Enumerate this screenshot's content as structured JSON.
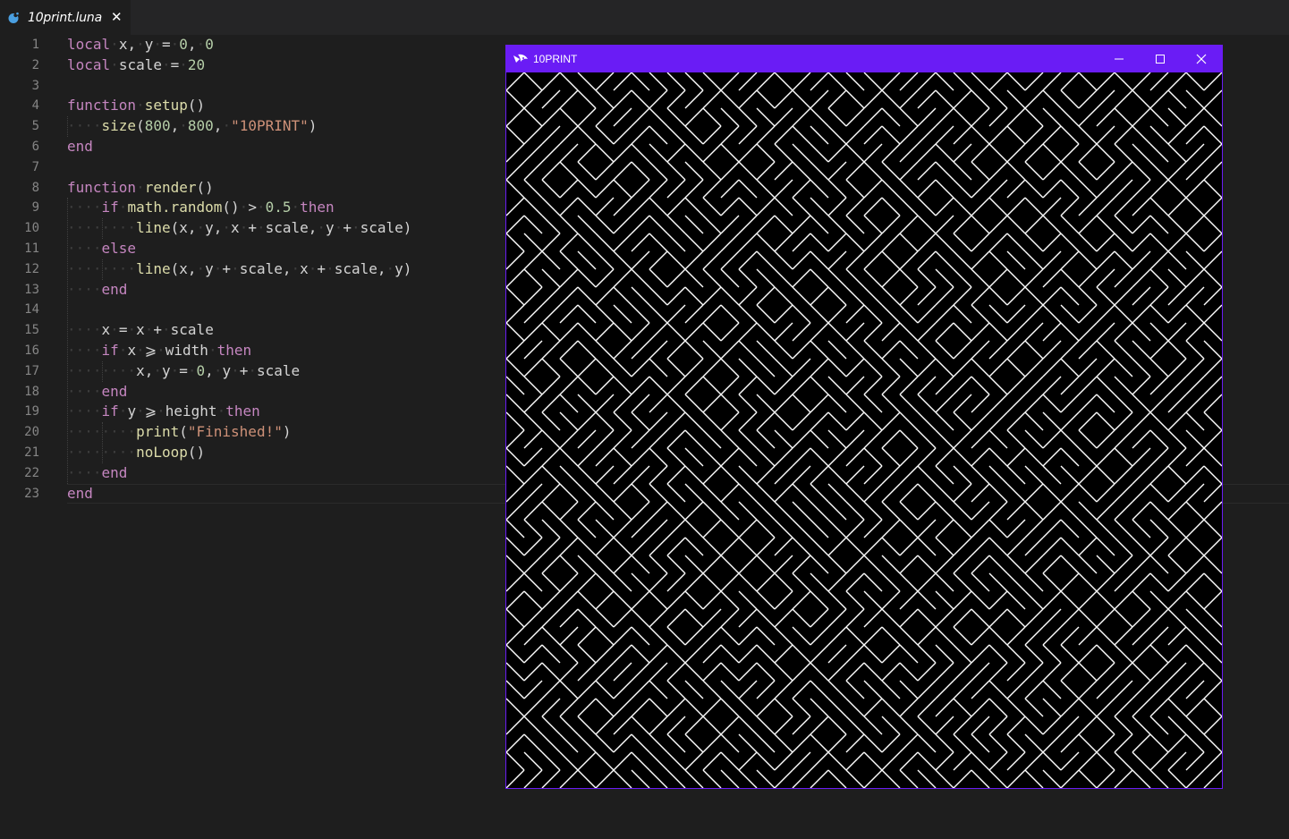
{
  "tab": {
    "title": "10print.luna",
    "icon": "luna-file-icon",
    "close_icon": "close-icon"
  },
  "colors": {
    "keyword": "#c586c0",
    "function": "#dcdcaa",
    "number": "#b5cea8",
    "string": "#ce9178",
    "window_accent": "#6a1cf5"
  },
  "editor": {
    "lines": [
      [
        [
          "k",
          "local"
        ],
        [
          "p",
          " x, y = "
        ],
        [
          "n",
          "0"
        ],
        [
          "p",
          ", "
        ],
        [
          "n",
          "0"
        ]
      ],
      [
        [
          "k",
          "local"
        ],
        [
          "p",
          " scale = "
        ],
        [
          "n",
          "20"
        ]
      ],
      [],
      [
        [
          "k",
          "function"
        ],
        [
          "p",
          " "
        ],
        [
          "f",
          "setup"
        ],
        [
          "p",
          "()"
        ]
      ],
      [
        [
          "w",
          "    "
        ],
        [
          "f",
          "size"
        ],
        [
          "p",
          "("
        ],
        [
          "n",
          "800"
        ],
        [
          "p",
          ", "
        ],
        [
          "n",
          "800"
        ],
        [
          "p",
          ", "
        ],
        [
          "s",
          "\"10PRINT\""
        ],
        [
          "p",
          ")"
        ]
      ],
      [
        [
          "k",
          "end"
        ]
      ],
      [],
      [
        [
          "k",
          "function"
        ],
        [
          "p",
          " "
        ],
        [
          "f",
          "render"
        ],
        [
          "p",
          "()"
        ]
      ],
      [
        [
          "w",
          "    "
        ],
        [
          "k",
          "if"
        ],
        [
          "p",
          " "
        ],
        [
          "f",
          "math.random"
        ],
        [
          "p",
          "() > "
        ],
        [
          "n",
          "0.5"
        ],
        [
          "p",
          " "
        ],
        [
          "k",
          "then"
        ]
      ],
      [
        [
          "w",
          "        "
        ],
        [
          "f",
          "line"
        ],
        [
          "p",
          "(x, y, x + scale, y + scale)"
        ]
      ],
      [
        [
          "w",
          "    "
        ],
        [
          "k",
          "else"
        ]
      ],
      [
        [
          "w",
          "        "
        ],
        [
          "f",
          "line"
        ],
        [
          "p",
          "(x, y + scale, x + scale, y)"
        ]
      ],
      [
        [
          "w",
          "    "
        ],
        [
          "k",
          "end"
        ]
      ],
      [],
      [
        [
          "w",
          "    "
        ],
        [
          "p",
          "x = x + scale"
        ]
      ],
      [
        [
          "w",
          "    "
        ],
        [
          "k",
          "if"
        ],
        [
          "p",
          " x ⩾ width "
        ],
        [
          "k",
          "then"
        ]
      ],
      [
        [
          "w",
          "        "
        ],
        [
          "p",
          "x, y = "
        ],
        [
          "n",
          "0"
        ],
        [
          "p",
          ", y + scale"
        ]
      ],
      [
        [
          "w",
          "    "
        ],
        [
          "k",
          "end"
        ]
      ],
      [
        [
          "w",
          "    "
        ],
        [
          "k",
          "if"
        ],
        [
          "p",
          " y ⩾ height "
        ],
        [
          "k",
          "then"
        ]
      ],
      [
        [
          "w",
          "        "
        ],
        [
          "f",
          "print"
        ],
        [
          "p",
          "("
        ],
        [
          "s",
          "\"Finished!\""
        ],
        [
          "p",
          ")"
        ]
      ],
      [
        [
          "w",
          "        "
        ],
        [
          "f",
          "noLoop"
        ],
        [
          "p",
          "()"
        ]
      ],
      [
        [
          "w",
          "    "
        ],
        [
          "k",
          "end"
        ]
      ],
      [
        [
          "k",
          "end"
        ]
      ]
    ]
  },
  "sketch_window": {
    "title": "10PRINT",
    "logo": "luna-logo-icon",
    "minimize_icon": "minimize-icon",
    "maximize_icon": "maximize-icon",
    "close_icon": "close-icon",
    "canvas": {
      "cells": 40,
      "line_color": "#ffffff",
      "background": "#000000"
    }
  }
}
